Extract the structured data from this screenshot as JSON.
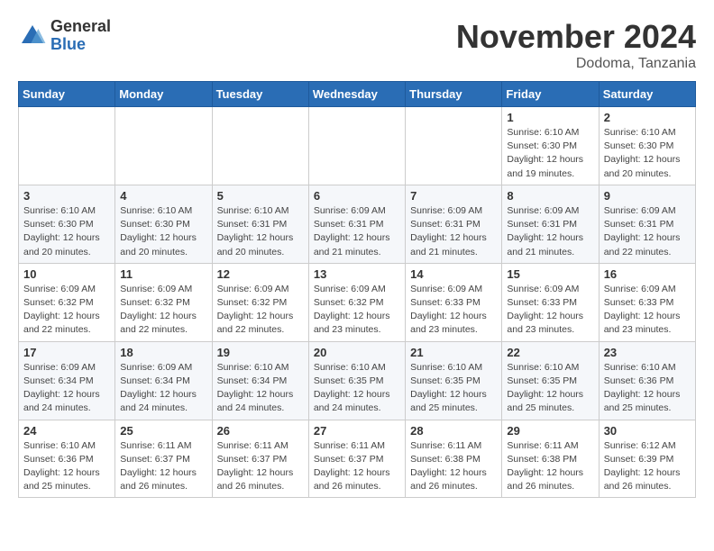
{
  "header": {
    "logo_general": "General",
    "logo_blue": "Blue",
    "month_title": "November 2024",
    "location": "Dodoma, Tanzania"
  },
  "days_of_week": [
    "Sunday",
    "Monday",
    "Tuesday",
    "Wednesday",
    "Thursday",
    "Friday",
    "Saturday"
  ],
  "weeks": [
    [
      {
        "day": "",
        "info": ""
      },
      {
        "day": "",
        "info": ""
      },
      {
        "day": "",
        "info": ""
      },
      {
        "day": "",
        "info": ""
      },
      {
        "day": "",
        "info": ""
      },
      {
        "day": "1",
        "info": "Sunrise: 6:10 AM\nSunset: 6:30 PM\nDaylight: 12 hours and 19 minutes."
      },
      {
        "day": "2",
        "info": "Sunrise: 6:10 AM\nSunset: 6:30 PM\nDaylight: 12 hours and 20 minutes."
      }
    ],
    [
      {
        "day": "3",
        "info": "Sunrise: 6:10 AM\nSunset: 6:30 PM\nDaylight: 12 hours and 20 minutes."
      },
      {
        "day": "4",
        "info": "Sunrise: 6:10 AM\nSunset: 6:30 PM\nDaylight: 12 hours and 20 minutes."
      },
      {
        "day": "5",
        "info": "Sunrise: 6:10 AM\nSunset: 6:31 PM\nDaylight: 12 hours and 20 minutes."
      },
      {
        "day": "6",
        "info": "Sunrise: 6:09 AM\nSunset: 6:31 PM\nDaylight: 12 hours and 21 minutes."
      },
      {
        "day": "7",
        "info": "Sunrise: 6:09 AM\nSunset: 6:31 PM\nDaylight: 12 hours and 21 minutes."
      },
      {
        "day": "8",
        "info": "Sunrise: 6:09 AM\nSunset: 6:31 PM\nDaylight: 12 hours and 21 minutes."
      },
      {
        "day": "9",
        "info": "Sunrise: 6:09 AM\nSunset: 6:31 PM\nDaylight: 12 hours and 22 minutes."
      }
    ],
    [
      {
        "day": "10",
        "info": "Sunrise: 6:09 AM\nSunset: 6:32 PM\nDaylight: 12 hours and 22 minutes."
      },
      {
        "day": "11",
        "info": "Sunrise: 6:09 AM\nSunset: 6:32 PM\nDaylight: 12 hours and 22 minutes."
      },
      {
        "day": "12",
        "info": "Sunrise: 6:09 AM\nSunset: 6:32 PM\nDaylight: 12 hours and 22 minutes."
      },
      {
        "day": "13",
        "info": "Sunrise: 6:09 AM\nSunset: 6:32 PM\nDaylight: 12 hours and 23 minutes."
      },
      {
        "day": "14",
        "info": "Sunrise: 6:09 AM\nSunset: 6:33 PM\nDaylight: 12 hours and 23 minutes."
      },
      {
        "day": "15",
        "info": "Sunrise: 6:09 AM\nSunset: 6:33 PM\nDaylight: 12 hours and 23 minutes."
      },
      {
        "day": "16",
        "info": "Sunrise: 6:09 AM\nSunset: 6:33 PM\nDaylight: 12 hours and 23 minutes."
      }
    ],
    [
      {
        "day": "17",
        "info": "Sunrise: 6:09 AM\nSunset: 6:34 PM\nDaylight: 12 hours and 24 minutes."
      },
      {
        "day": "18",
        "info": "Sunrise: 6:09 AM\nSunset: 6:34 PM\nDaylight: 12 hours and 24 minutes."
      },
      {
        "day": "19",
        "info": "Sunrise: 6:10 AM\nSunset: 6:34 PM\nDaylight: 12 hours and 24 minutes."
      },
      {
        "day": "20",
        "info": "Sunrise: 6:10 AM\nSunset: 6:35 PM\nDaylight: 12 hours and 24 minutes."
      },
      {
        "day": "21",
        "info": "Sunrise: 6:10 AM\nSunset: 6:35 PM\nDaylight: 12 hours and 25 minutes."
      },
      {
        "day": "22",
        "info": "Sunrise: 6:10 AM\nSunset: 6:35 PM\nDaylight: 12 hours and 25 minutes."
      },
      {
        "day": "23",
        "info": "Sunrise: 6:10 AM\nSunset: 6:36 PM\nDaylight: 12 hours and 25 minutes."
      }
    ],
    [
      {
        "day": "24",
        "info": "Sunrise: 6:10 AM\nSunset: 6:36 PM\nDaylight: 12 hours and 25 minutes."
      },
      {
        "day": "25",
        "info": "Sunrise: 6:11 AM\nSunset: 6:37 PM\nDaylight: 12 hours and 26 minutes."
      },
      {
        "day": "26",
        "info": "Sunrise: 6:11 AM\nSunset: 6:37 PM\nDaylight: 12 hours and 26 minutes."
      },
      {
        "day": "27",
        "info": "Sunrise: 6:11 AM\nSunset: 6:37 PM\nDaylight: 12 hours and 26 minutes."
      },
      {
        "day": "28",
        "info": "Sunrise: 6:11 AM\nSunset: 6:38 PM\nDaylight: 12 hours and 26 minutes."
      },
      {
        "day": "29",
        "info": "Sunrise: 6:11 AM\nSunset: 6:38 PM\nDaylight: 12 hours and 26 minutes."
      },
      {
        "day": "30",
        "info": "Sunrise: 6:12 AM\nSunset: 6:39 PM\nDaylight: 12 hours and 26 minutes."
      }
    ]
  ],
  "colors": {
    "header_bg": "#2a6db5",
    "accent": "#2a6db5"
  }
}
